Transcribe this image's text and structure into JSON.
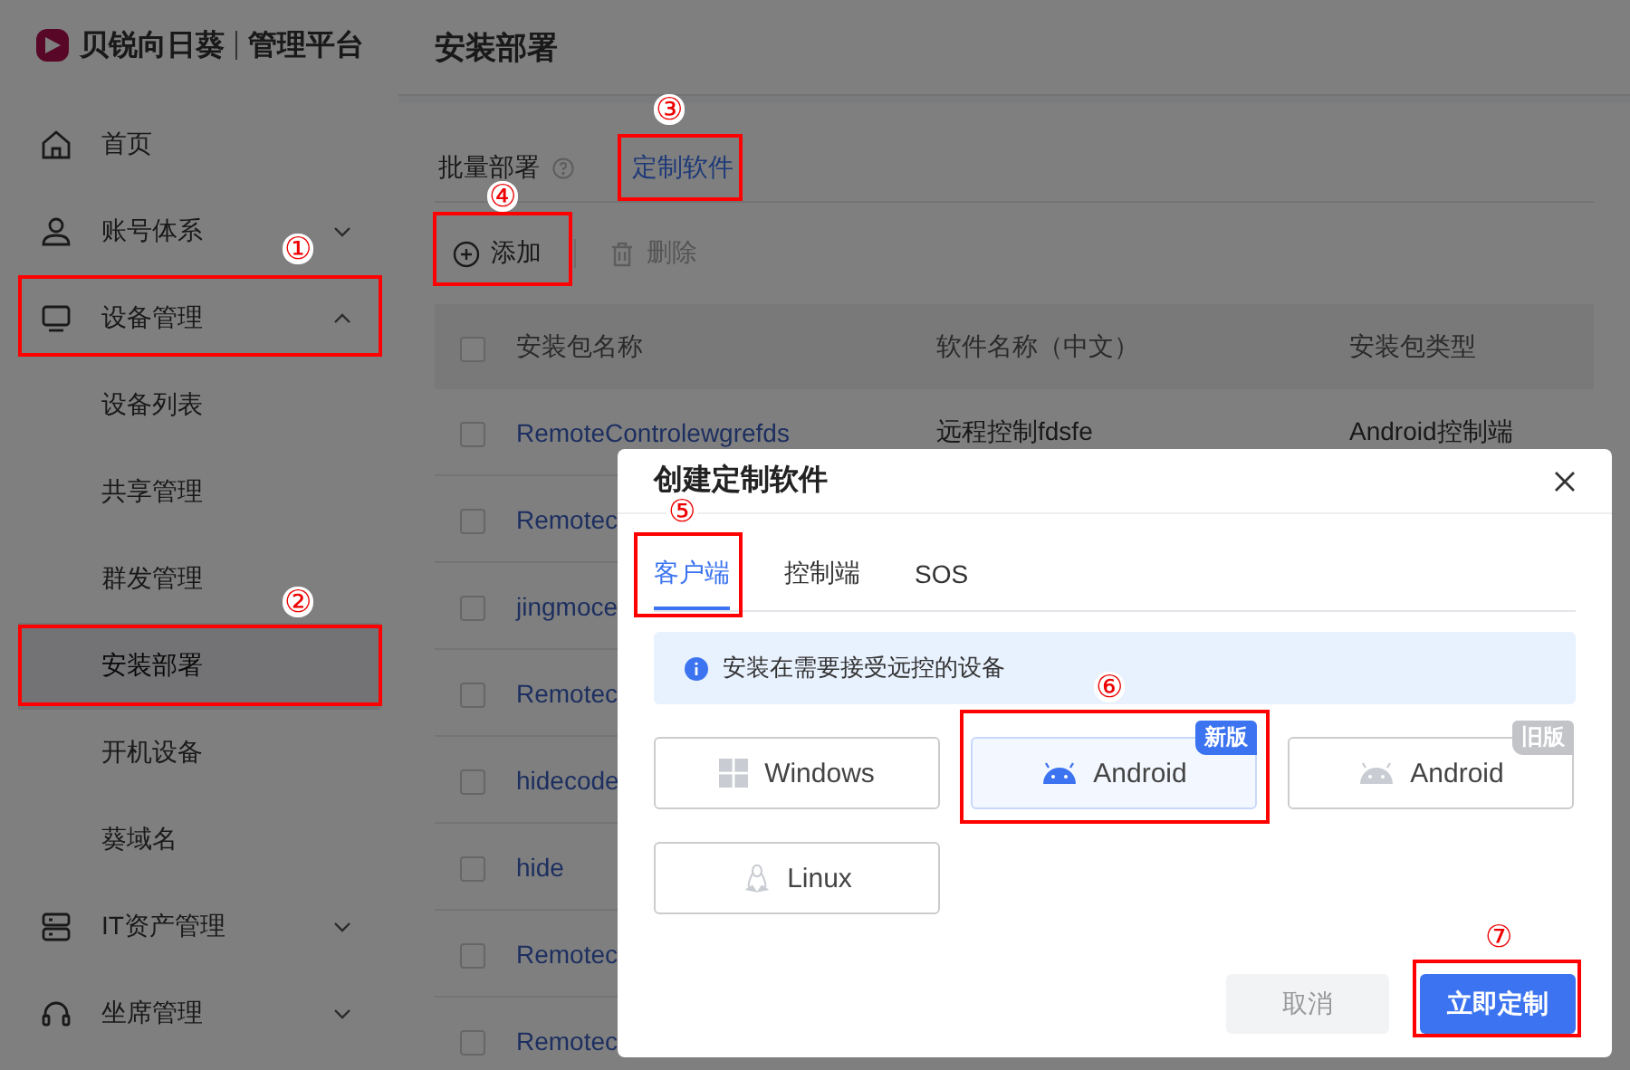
{
  "brand": {
    "name": "贝锐向日葵",
    "product": "管理平台"
  },
  "sidebar": {
    "items": [
      {
        "label": "首页",
        "selected": false
      },
      {
        "label": "账号体系",
        "selected": false,
        "expanded": false
      },
      {
        "label": "设备管理",
        "selected": false,
        "expanded": true,
        "children": [
          {
            "label": "设备列表",
            "selected": false
          },
          {
            "label": "共享管理",
            "selected": false
          },
          {
            "label": "群发管理",
            "selected": false
          },
          {
            "label": "安装部署",
            "selected": true
          },
          {
            "label": "开机设备",
            "selected": false
          },
          {
            "label": "葵域名",
            "selected": false
          }
        ]
      },
      {
        "label": "IT资产管理",
        "selected": false,
        "expanded": false
      },
      {
        "label": "坐席管理",
        "selected": false,
        "expanded": false
      }
    ]
  },
  "page_title": "安装部署",
  "tabs": [
    {
      "label": "批量部署",
      "help": true,
      "selected": false
    },
    {
      "label": "定制软件",
      "help": false,
      "selected": true
    }
  ],
  "toolbar": [
    {
      "label": "添加",
      "kind": "add",
      "disabled": false
    },
    {
      "label": "删除",
      "kind": "delete",
      "disabled": true
    }
  ],
  "table": {
    "columns": [
      "安装包名称",
      "软件名称（中文）",
      "安装包类型"
    ],
    "header_checked": false,
    "rows": [
      {
        "checked": false,
        "cells": [
          "RemoteControlewgrefds",
          "远程控制fdsfe",
          "Android控制端"
        ]
      },
      {
        "checked": false,
        "cells": [
          "Remotec"
        ]
      },
      {
        "checked": false,
        "cells": [
          "jingmoce"
        ]
      },
      {
        "checked": false,
        "cells": [
          "Remotec"
        ]
      },
      {
        "checked": false,
        "cells": [
          "hidecode"
        ]
      },
      {
        "checked": false,
        "cells": [
          "hide"
        ]
      },
      {
        "checked": false,
        "cells": [
          "Remotec"
        ]
      },
      {
        "checked": false,
        "cells": [
          "Remotec"
        ]
      }
    ]
  },
  "dialog": {
    "title": "创建定制软件",
    "tabs": [
      {
        "label": "客户端",
        "selected": true
      },
      {
        "label": "控制端",
        "selected": false
      },
      {
        "label": "SOS",
        "selected": false
      }
    ],
    "info": "安装在需要接受远控的设备",
    "options": [
      {
        "label": "Windows",
        "kind": "windows",
        "selected": false
      },
      {
        "label": "Android",
        "kind": "android",
        "selected": true,
        "badge": {
          "text": "新版",
          "kind": "new"
        }
      },
      {
        "label": "Android",
        "kind": "android",
        "selected": false,
        "badge": {
          "text": "旧版",
          "kind": "old"
        }
      },
      {
        "label": "Linux",
        "kind": "linux",
        "selected": false
      }
    ],
    "buttons": [
      {
        "label": "取消",
        "kind": "cancel",
        "disabled": true
      },
      {
        "label": "立即定制",
        "kind": "primary",
        "disabled": false
      }
    ]
  },
  "annotations": [
    {
      "number": "①"
    },
    {
      "number": "②"
    },
    {
      "number": "③"
    },
    {
      "number": "④"
    },
    {
      "number": "⑤"
    },
    {
      "number": "⑥"
    },
    {
      "number": "⑦"
    }
  ]
}
